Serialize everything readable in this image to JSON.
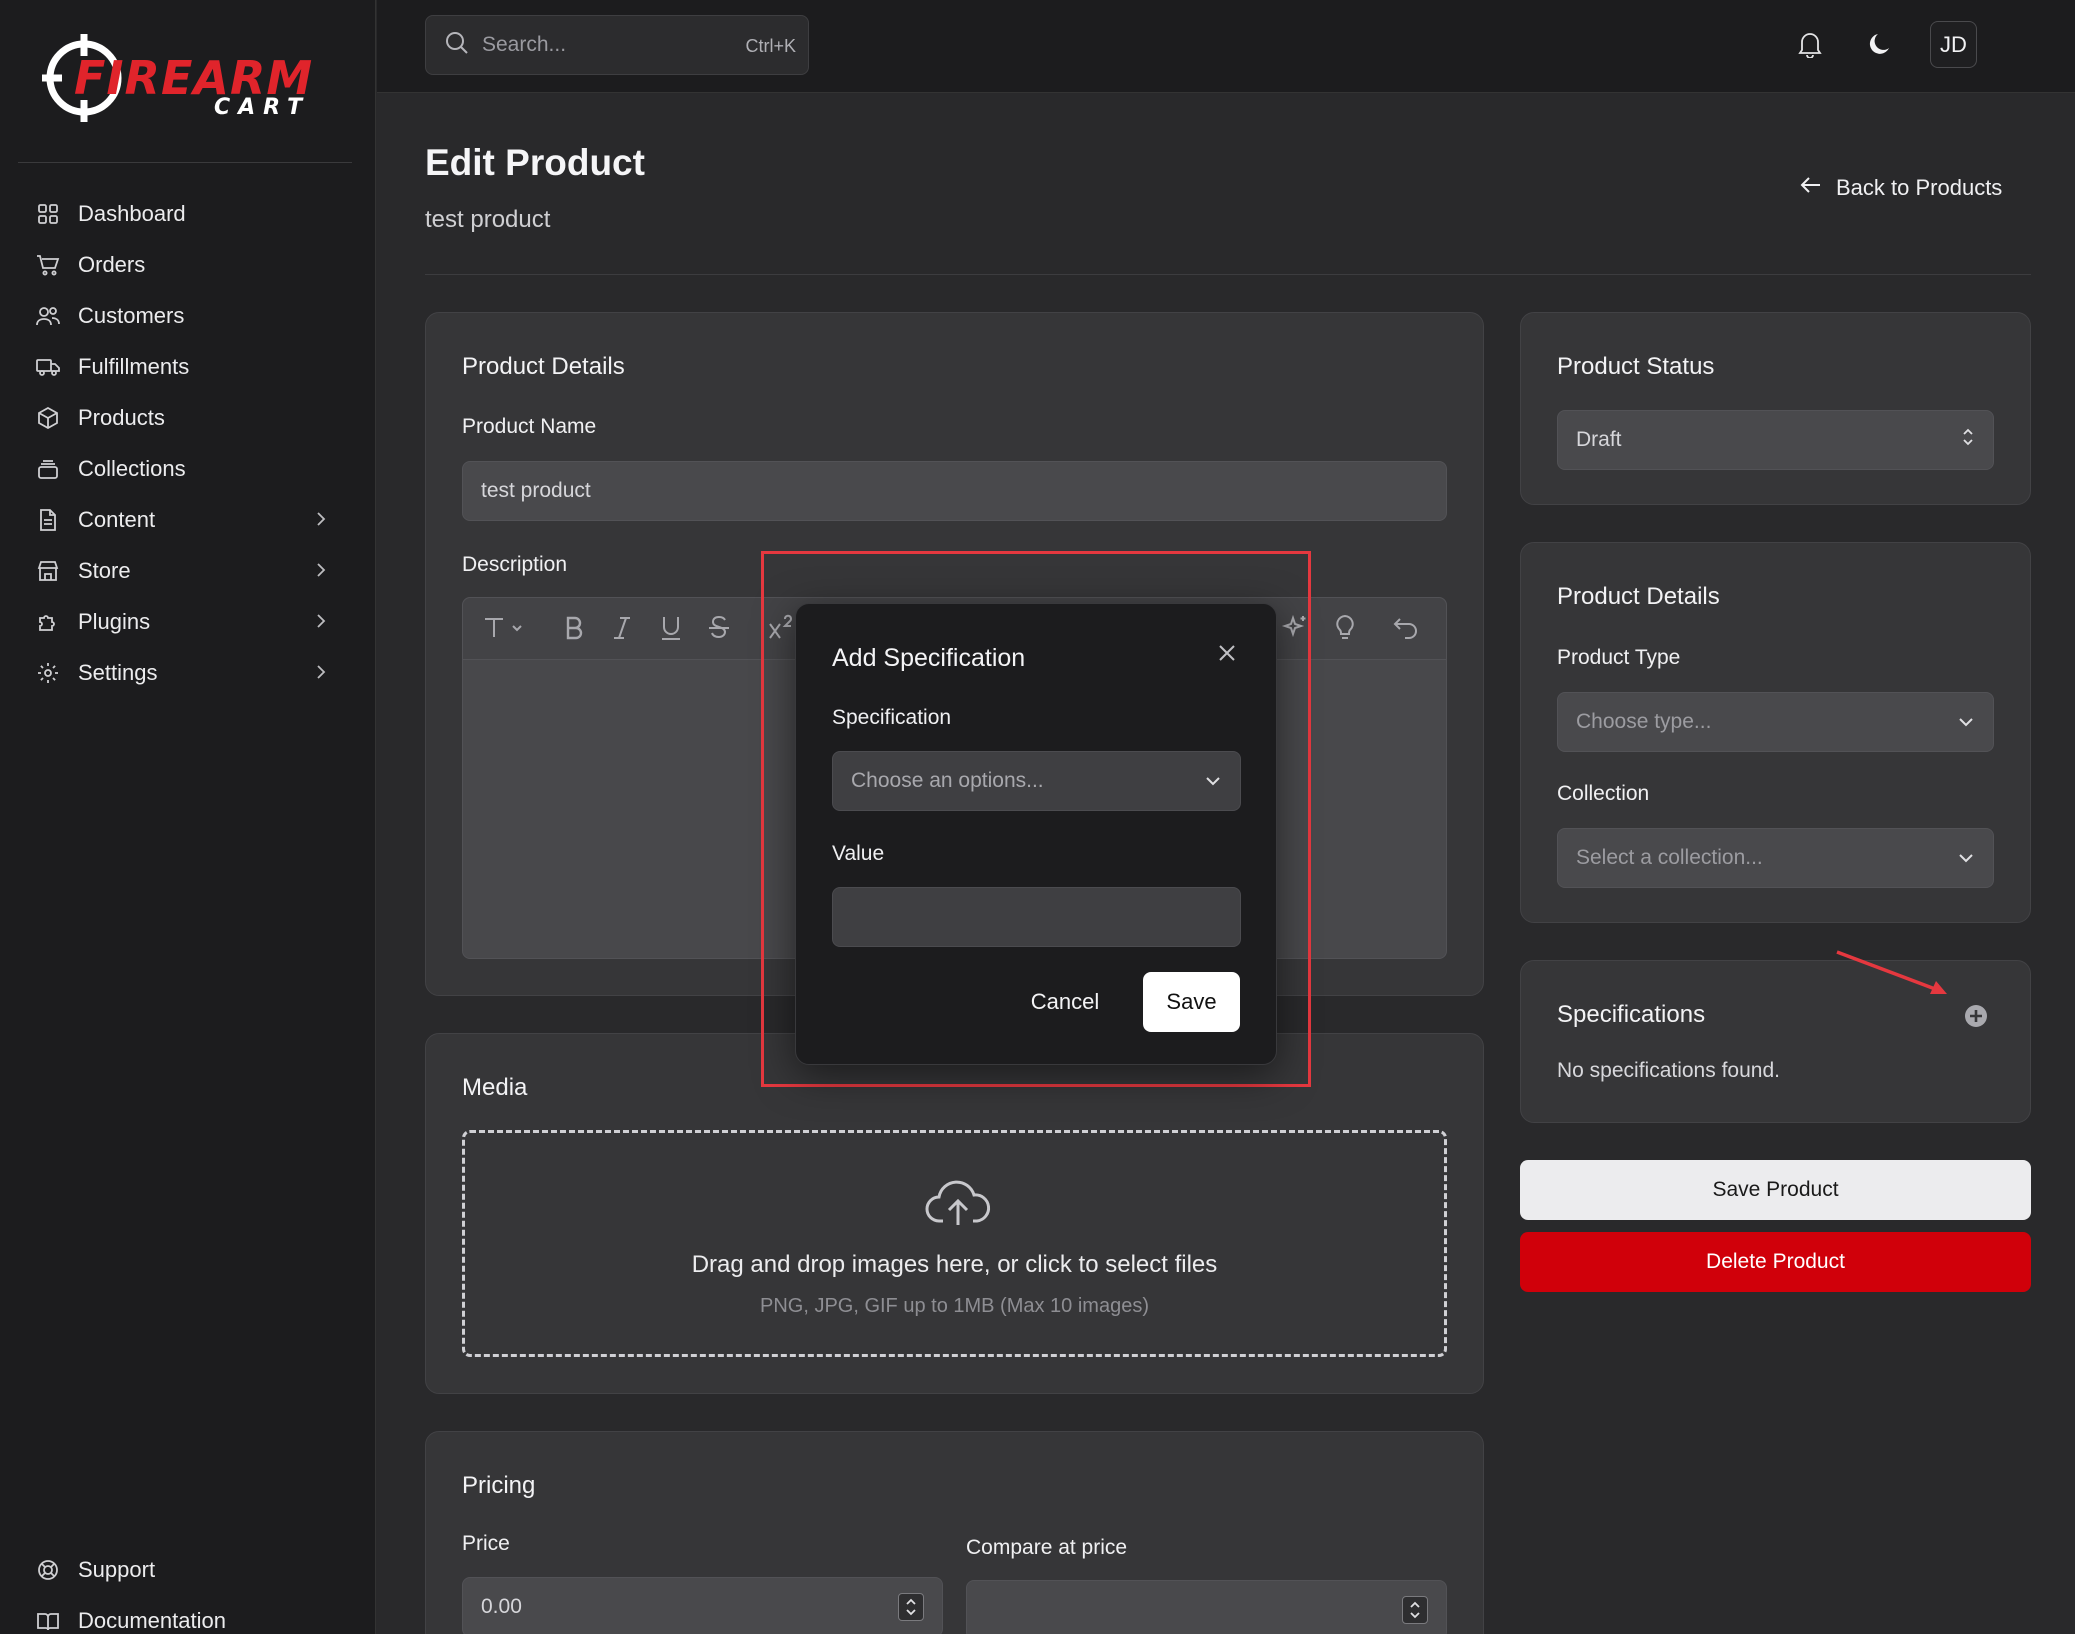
{
  "brand": {
    "logo_main": "FIREARM",
    "logo_sub": "CART",
    "colors": {
      "accent": "#d0000a",
      "logo_red": "#e0242b",
      "background": "#29292b",
      "sidebar": "#1c1c1e",
      "card": "#363638",
      "highlight": "#e5383f"
    }
  },
  "sidebar": {
    "items": [
      {
        "label": "Dashboard",
        "icon": "grid-icon"
      },
      {
        "label": "Orders",
        "icon": "cart-icon"
      },
      {
        "label": "Customers",
        "icon": "users-icon"
      },
      {
        "label": "Fulfillments",
        "icon": "truck-icon"
      },
      {
        "label": "Products",
        "icon": "box-icon"
      },
      {
        "label": "Collections",
        "icon": "stack-icon"
      },
      {
        "label": "Content",
        "icon": "document-icon",
        "expandable": true
      },
      {
        "label": "Store",
        "icon": "store-icon",
        "expandable": true
      },
      {
        "label": "Plugins",
        "icon": "puzzle-icon",
        "expandable": true
      },
      {
        "label": "Settings",
        "icon": "gear-icon",
        "expandable": true
      }
    ],
    "bottom_items": [
      {
        "label": "Support",
        "icon": "lifebuoy-icon"
      },
      {
        "label": "Documentation",
        "icon": "book-icon"
      }
    ]
  },
  "topbar": {
    "search_placeholder": "Search...",
    "search_shortcut": "Ctrl+K",
    "avatar_initials": "JD"
  },
  "header": {
    "title": "Edit Product",
    "subtitle": "test product",
    "back_label": "Back to Products"
  },
  "product_details": {
    "title": "Product Details",
    "name_label": "Product Name",
    "name_value": "test product",
    "description_label": "Description"
  },
  "media": {
    "title": "Media",
    "drop_text": "Drag and drop images here, or click to select files",
    "drop_hint": "PNG, JPG, GIF up to 1MB (Max 10 images)"
  },
  "pricing": {
    "title": "Pricing",
    "price_label": "Price",
    "price_value": "0.00",
    "compare_label": "Compare at price",
    "compare_value": ""
  },
  "status": {
    "title": "Product Status",
    "value": "Draft"
  },
  "side_details": {
    "title": "Product Details",
    "type_label": "Product Type",
    "type_placeholder": "Choose type...",
    "collection_label": "Collection",
    "collection_placeholder": "Select a collection..."
  },
  "specifications": {
    "title": "Specifications",
    "empty_text": "No specifications found."
  },
  "actions": {
    "save_label": "Save Product",
    "delete_label": "Delete Product"
  },
  "modal": {
    "title": "Add Specification",
    "spec_label": "Specification",
    "spec_placeholder": "Choose an options...",
    "value_label": "Value",
    "value_value": "",
    "cancel_label": "Cancel",
    "save_label": "Save"
  }
}
